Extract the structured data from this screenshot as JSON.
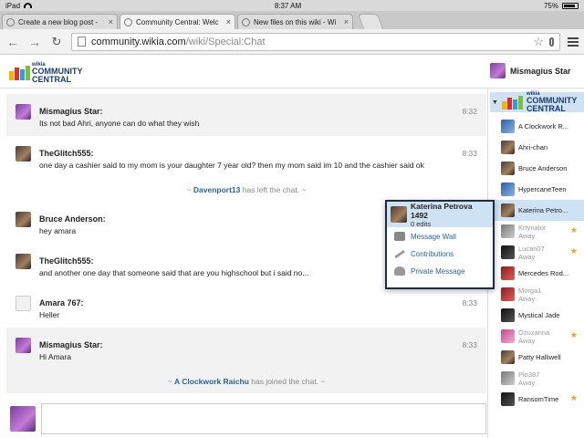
{
  "status": {
    "device": "iPad",
    "time": "8:37 AM",
    "battery": "75%"
  },
  "tabs": [
    {
      "label": "Create a new blog post -",
      "active": false
    },
    {
      "label": "Community Central: Welc",
      "active": true
    },
    {
      "label": "New files on this wiki - Wi",
      "active": false
    }
  ],
  "tab_close_glyph": "×",
  "toolbar": {
    "url_host": "community.wikia.com",
    "url_path": "/wiki/Special:Chat"
  },
  "logo": {
    "line1": "wikia",
    "line2": "COMMUNITY",
    "line3": "CENTRAL"
  },
  "me": {
    "name": "Mismagius Star"
  },
  "messages": [
    {
      "type": "msg",
      "user": "Mismagius Star:",
      "text": "Its not bad Ahri, anyone can do what they wish",
      "time": "8:32",
      "avatar": "purple",
      "alt": true
    },
    {
      "type": "msg",
      "user": "TheGlitch555:",
      "text": "one day a cashier said to my mom is your daughter 7 year old? then my mom said im 10 and the cashier said ok",
      "time": "8:33",
      "avatar": "dark",
      "alt": false
    },
    {
      "type": "inline",
      "prefix": "~ ",
      "who": "Davenport13",
      "suffix": " has left the chat. ~",
      "alt": false
    },
    {
      "type": "msg",
      "user": "Bruce Anderson:",
      "text": "hey amara",
      "time": "",
      "avatar": "dark",
      "alt": false
    },
    {
      "type": "msg",
      "user": "TheGlitch555:",
      "text": "and another one day that someone said that are you highschool but i said no...",
      "time": "",
      "avatar": "dark",
      "alt": false
    },
    {
      "type": "msg",
      "user": "Amara 767:",
      "text": "Heller",
      "time": "8:33",
      "avatar": "light",
      "alt": false
    },
    {
      "type": "msg",
      "user": "Mismagius Star:",
      "text": "Hi Amara",
      "time": "8:33",
      "avatar": "purple",
      "alt": true
    },
    {
      "type": "inline",
      "prefix": "~ ",
      "who": "A Clockwork Raichu",
      "suffix": " has joined the chat. ~",
      "alt": true
    }
  ],
  "sidebar": {
    "users": [
      {
        "name": "A Clockwork R...",
        "away": "",
        "avatar": "blue",
        "star": false,
        "selected": false
      },
      {
        "name": "Ahri-chan",
        "away": "",
        "avatar": "dark",
        "star": false,
        "selected": false
      },
      {
        "name": "Bruce Anderson",
        "away": "",
        "avatar": "dark",
        "star": false,
        "selected": false
      },
      {
        "name": "HypercaneTeen",
        "away": "",
        "avatar": "blue",
        "star": false,
        "selected": false
      },
      {
        "name": "Katerina Petro...",
        "away": "",
        "avatar": "dark",
        "star": false,
        "selected": true
      },
      {
        "name": "Krtynator",
        "away": "Away",
        "avatar": "gray",
        "star": true,
        "selected": false
      },
      {
        "name": "Lucan07",
        "away": "Away",
        "avatar": "black",
        "star": true,
        "selected": false
      },
      {
        "name": "Mercedes Rod...",
        "away": "",
        "avatar": "red",
        "star": false,
        "selected": false
      },
      {
        "name": "Morga1",
        "away": "Away",
        "avatar": "red",
        "star": false,
        "selected": false
      },
      {
        "name": "Mystical Jade",
        "away": "",
        "avatar": "black",
        "star": false,
        "selected": false
      },
      {
        "name": "Ozuzanna",
        "away": "Away",
        "avatar": "pink",
        "star": true,
        "selected": false
      },
      {
        "name": "Patty Halliwell",
        "away": "",
        "avatar": "dark",
        "star": false,
        "selected": false
      },
      {
        "name": "Plo387",
        "away": "Away",
        "avatar": "gray",
        "star": false,
        "selected": false
      },
      {
        "name": "RansomTime",
        "away": "",
        "avatar": "black",
        "star": true,
        "selected": false
      }
    ]
  },
  "popup": {
    "name": "Katerina Petrova 1492",
    "edits": "0 edits",
    "actions": [
      "Message Wall",
      "Contributions",
      "Private Message"
    ]
  },
  "colors": {
    "accent": "#2a6496",
    "selected": "#cfe2f3",
    "star": "#f0a020",
    "popup_border": "#1f2a44"
  }
}
